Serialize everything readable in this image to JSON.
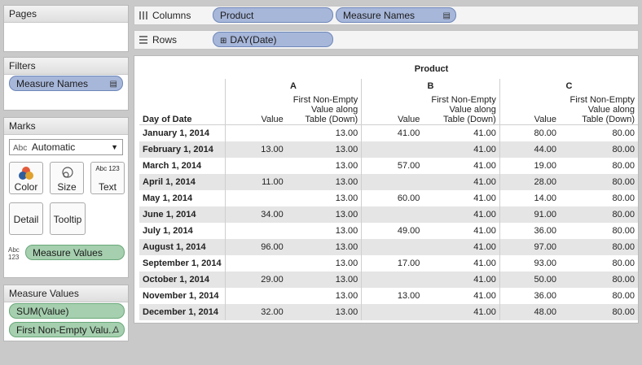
{
  "panels": {
    "pages": {
      "title": "Pages"
    },
    "filters": {
      "title": "Filters",
      "pills": [
        "Measure Names"
      ]
    },
    "marks": {
      "title": "Marks",
      "type_value": "Automatic",
      "buttons": {
        "color": "Color",
        "size": "Size",
        "text": "Text",
        "detail": "Detail",
        "tooltip": "Tooltip"
      },
      "text_pill": "Measure Values"
    },
    "measure_values": {
      "title": "Measure Values",
      "pills": [
        "SUM(Value)",
        "First Non-Empty Valu.."
      ]
    }
  },
  "shelves": {
    "columns": {
      "label": "Columns",
      "pills": [
        "Product",
        "Measure Names"
      ]
    },
    "rows": {
      "label": "Rows",
      "pills": [
        "DAY(Date)"
      ]
    }
  },
  "view": {
    "header_product": "Product",
    "groups": [
      "A",
      "B",
      "C"
    ],
    "row_header": "Day of Date",
    "measure_value": "Value",
    "measure_fne": [
      "First Non-Empty",
      "Value along",
      "Table (Down)"
    ],
    "rows": [
      {
        "date": "January 1, 2014",
        "a_val": "",
        "a_fne": "13.00",
        "b_val": "41.00",
        "b_fne": "41.00",
        "c_val": "80.00",
        "c_fne": "80.00"
      },
      {
        "date": "February 1, 2014",
        "a_val": "13.00",
        "a_fne": "13.00",
        "b_val": "",
        "b_fne": "41.00",
        "c_val": "44.00",
        "c_fne": "80.00"
      },
      {
        "date": "March 1, 2014",
        "a_val": "",
        "a_fne": "13.00",
        "b_val": "57.00",
        "b_fne": "41.00",
        "c_val": "19.00",
        "c_fne": "80.00"
      },
      {
        "date": "April 1, 2014",
        "a_val": "11.00",
        "a_fne": "13.00",
        "b_val": "",
        "b_fne": "41.00",
        "c_val": "28.00",
        "c_fne": "80.00"
      },
      {
        "date": "May 1, 2014",
        "a_val": "",
        "a_fne": "13.00",
        "b_val": "60.00",
        "b_fne": "41.00",
        "c_val": "14.00",
        "c_fne": "80.00"
      },
      {
        "date": "June 1, 2014",
        "a_val": "34.00",
        "a_fne": "13.00",
        "b_val": "",
        "b_fne": "41.00",
        "c_val": "91.00",
        "c_fne": "80.00"
      },
      {
        "date": "July 1, 2014",
        "a_val": "",
        "a_fne": "13.00",
        "b_val": "49.00",
        "b_fne": "41.00",
        "c_val": "36.00",
        "c_fne": "80.00"
      },
      {
        "date": "August 1, 2014",
        "a_val": "96.00",
        "a_fne": "13.00",
        "b_val": "",
        "b_fne": "41.00",
        "c_val": "97.00",
        "c_fne": "80.00"
      },
      {
        "date": "September 1, 2014",
        "a_val": "",
        "a_fne": "13.00",
        "b_val": "17.00",
        "b_fne": "41.00",
        "c_val": "93.00",
        "c_fne": "80.00"
      },
      {
        "date": "October 1, 2014",
        "a_val": "29.00",
        "a_fne": "13.00",
        "b_val": "",
        "b_fne": "41.00",
        "c_val": "50.00",
        "c_fne": "80.00"
      },
      {
        "date": "November 1, 2014",
        "a_val": "",
        "a_fne": "13.00",
        "b_val": "13.00",
        "b_fne": "41.00",
        "c_val": "36.00",
        "c_fne": "80.00"
      },
      {
        "date": "December 1, 2014",
        "a_val": "32.00",
        "a_fne": "13.00",
        "b_val": "",
        "b_fne": "41.00",
        "c_val": "48.00",
        "c_fne": "80.00"
      }
    ]
  },
  "icons": {
    "text_icon": "Abc 123",
    "mark_type_icon": "Abc",
    "delta": "Δ"
  }
}
